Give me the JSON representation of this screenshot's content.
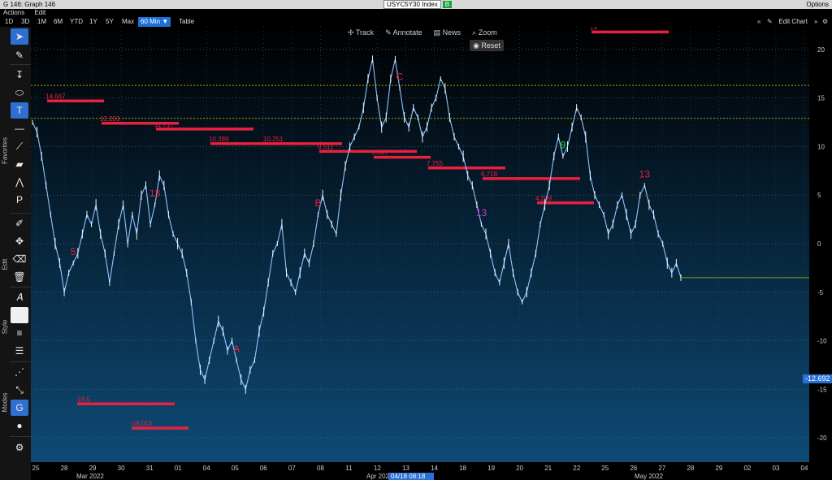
{
  "window": {
    "title": "G 146: Graph 146",
    "ticker": "USYC5Y30 Index",
    "badge": "B",
    "options": "Options"
  },
  "menu": {
    "actions": "Actions",
    "edit": "Edit"
  },
  "ranges": [
    "1D",
    "3D",
    "1M",
    "6M",
    "YTD",
    "1Y",
    "5Y",
    "Max"
  ],
  "selected_range": "60 Min",
  "table_label": "Table",
  "edit_chart": "Edit Chart",
  "overlay_tools": {
    "track": "Track",
    "annotate": "Annotate",
    "news": "News",
    "zoom": "Zoom",
    "reset": "Reset"
  },
  "sidebar": {
    "favorites": "Favorites",
    "edit": "Edit",
    "style": "Style",
    "modes": "Modes"
  },
  "last_price": "-12.692",
  "cursor_label": "04/18 08:18",
  "colors": {
    "bg_top": "#000000",
    "bg_bottom": "#0e4a76",
    "price": "#8ec5ff",
    "level": "#e8213e",
    "buy": "#27d63c",
    "sell": "#e8213e",
    "alt": "#c838d8"
  },
  "chart_data": {
    "type": "line",
    "ylim": [
      -22,
      22
    ],
    "yticks": [
      20,
      15,
      10,
      5,
      0,
      -5,
      -10,
      -15,
      -20
    ],
    "yticklabels": [
      "20",
      "15",
      "10",
      "5",
      "0",
      "-5",
      "-10",
      "-15",
      "-20"
    ],
    "xticklabels": [
      "25",
      "28",
      "29",
      "30",
      "31",
      "01",
      "04",
      "05",
      "06",
      "07",
      "08",
      "11",
      "12",
      "13",
      "14",
      "18",
      "19",
      "20",
      "21",
      "22",
      "25",
      "26",
      "27",
      "28",
      "29",
      "02",
      "03",
      "04"
    ],
    "month_labels": [
      "Mar 2022",
      "Apr 2022",
      "May 2022"
    ],
    "series": [
      {
        "values": [
          12.5,
          11.5,
          9,
          6,
          3,
          0,
          -2,
          -5,
          -3,
          -2,
          -1,
          1,
          3,
          2,
          4,
          1,
          -1,
          -4,
          -1,
          2,
          4,
          0,
          3,
          1,
          5,
          6,
          2,
          4,
          7,
          6,
          3,
          1,
          0,
          -1,
          -3,
          -6,
          -10,
          -13,
          -14,
          -12,
          -10,
          -8,
          -9,
          -11,
          -10,
          -12,
          -14,
          -15,
          -13,
          -12,
          -9,
          -7,
          -4,
          -1,
          0,
          2,
          -3,
          -4,
          -5,
          -3,
          -1,
          -2,
          0,
          3,
          5,
          3,
          2,
          1,
          5,
          8,
          10,
          11,
          12,
          14,
          17,
          19,
          15,
          12,
          13,
          17,
          19,
          16,
          13,
          12,
          14,
          13,
          11,
          12,
          14,
          15,
          17,
          16,
          13,
          11,
          10,
          9,
          7,
          6,
          4,
          2,
          1,
          -1,
          -3,
          -4,
          -2,
          0,
          -3,
          -5,
          -6,
          -5,
          -3,
          -1,
          2,
          4,
          6,
          9,
          11,
          9,
          10,
          12,
          14,
          13,
          11,
          7,
          5,
          4,
          3,
          1,
          2,
          4,
          5,
          3,
          1,
          2,
          5,
          6,
          4,
          3,
          1,
          0,
          -2,
          -3,
          -2,
          -3.5
        ]
      }
    ],
    "dashed_levels": [
      12.9,
      16.3
    ],
    "resistance_levels": [
      {
        "label": "14.667",
        "y": 14.7
      },
      {
        "label": "12.293",
        "y": 12.4
      },
      {
        "label": "11.717",
        "y": 11.8
      },
      {
        "label": "10.289",
        "y": 10.3
      },
      {
        "label": "10.251",
        "y": 10.3
      },
      {
        "label": "9.511",
        "y": 9.5
      },
      {
        "label": "8.887",
        "y": 8.9
      },
      {
        "label": "7.755",
        "y": 7.8
      },
      {
        "label": "6.718",
        "y": 6.7
      },
      {
        "label": "4.209",
        "y": 4.2
      },
      {
        "label": "19",
        "y": 21.8
      },
      {
        "label": "-16.5",
        "y": -16.5
      },
      {
        "label": "-19.013",
        "y": -19.0
      }
    ],
    "annotations": [
      {
        "text": "5",
        "color": "sell"
      },
      {
        "text": "13",
        "color": "sell"
      },
      {
        "text": "A",
        "color": "sell"
      },
      {
        "text": "B",
        "color": "sell"
      },
      {
        "text": "C",
        "color": "sell"
      },
      {
        "text": "13",
        "color": "alt"
      },
      {
        "text": "9",
        "color": "buy"
      },
      {
        "text": "13",
        "color": "sell"
      }
    ]
  }
}
